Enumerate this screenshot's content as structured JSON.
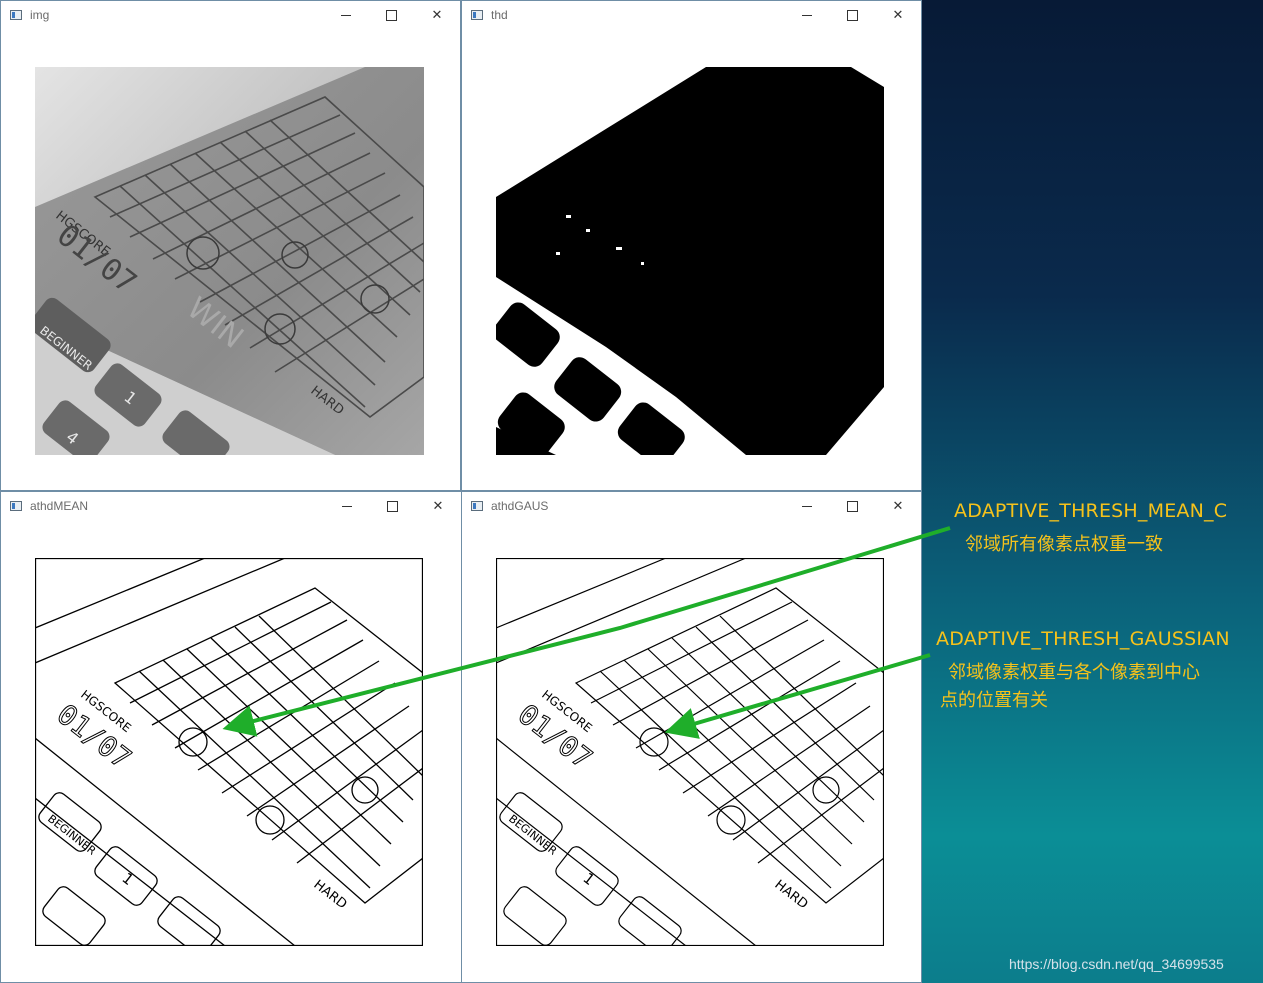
{
  "windows": [
    {
      "title": "img"
    },
    {
      "title": "thd"
    },
    {
      "title": "athdMEAN"
    },
    {
      "title": "athdGAUS"
    }
  ],
  "image_labels": {
    "hgscore": "HGSCORE",
    "beginner": "BEGINNER",
    "hard": "HARD",
    "key_1": "1",
    "key_4": "4",
    "win": "WIN",
    "time": "01/07"
  },
  "annotations": {
    "mean": {
      "title": "ADAPTIVE_THRESH_MEAN_C",
      "desc": "邻域所有像素点权重一致"
    },
    "gaussian": {
      "title": "ADAPTIVE_THRESH_GAUSSIAN",
      "desc_line1": "邻域像素权重与各个像素到中心",
      "desc_line2": "点的位置有关"
    }
  },
  "watermark": "https://blog.csdn.net/qq_34699535",
  "colors": {
    "annotation_text": "#f6c21b",
    "arrow": "#1fae2a"
  }
}
